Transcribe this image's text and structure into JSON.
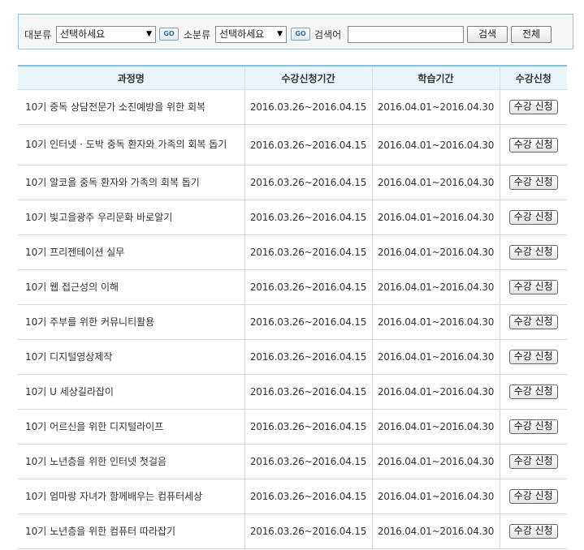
{
  "search": {
    "major_label": "대분류",
    "major_value": "선택하세요",
    "go_label": "GO",
    "minor_label": "소분류",
    "minor_value": "선택하세요",
    "keyword_label": "검색어",
    "keyword_value": "",
    "search_button": "검색",
    "all_button": "전체"
  },
  "table": {
    "headers": [
      "과정명",
      "수강신청기간",
      "학습기간",
      "수강신청"
    ],
    "apply_label": "수강 신청",
    "rows": [
      {
        "name": "10기 중독 상담전문가 소진예방을 위한 회복",
        "apply_period": "2016.03.26~2016.04.15",
        "study_period": "2016.04.01~2016.04.30"
      },
      {
        "name": "10기 인터넷 · 도박 중독 환자와 가족의 회복 돕기",
        "apply_period": "2016.03.26~2016.04.15",
        "study_period": "2016.04.01~2016.04.30"
      },
      {
        "name": "10기 알코올 중독 환자와 가족의 회복 돕기",
        "apply_period": "2016.03.26~2016.04.15",
        "study_period": "2016.04.01~2016.04.30"
      },
      {
        "name": "10기 빛고을광주 우리문화 바로알기",
        "apply_period": "2016.03.26~2016.04.15",
        "study_period": "2016.04.01~2016.04.30"
      },
      {
        "name": "10기 프리젠테이션 실무",
        "apply_period": "2016.03.26~2016.04.15",
        "study_period": "2016.04.01~2016.04.30"
      },
      {
        "name": "10기 웹 접근성의 이해",
        "apply_period": "2016.03.26~2016.04.15",
        "study_period": "2016.04.01~2016.04.30"
      },
      {
        "name": "10기 주부를 위한 커뮤니티활용",
        "apply_period": "2016.03.26~2016.04.15",
        "study_period": "2016.04.01~2016.04.30"
      },
      {
        "name": "10기 디지털영상제작",
        "apply_period": "2016.03.26~2016.04.15",
        "study_period": "2016.04.01~2016.04.30"
      },
      {
        "name": "10기 U 세상길라잡이",
        "apply_period": "2016.03.26~2016.04.15",
        "study_period": "2016.04.01~2016.04.30"
      },
      {
        "name": "10기 어르신을 위한 디지털라이프",
        "apply_period": "2016.03.26~2016.04.15",
        "study_period": "2016.04.01~2016.04.30"
      },
      {
        "name": "10기 노년층을 위한 인터넷 첫걸음",
        "apply_period": "2016.03.26~2016.04.15",
        "study_period": "2016.04.01~2016.04.30"
      },
      {
        "name": "10기 엄마랑 자녀가 함께배우는 컴퓨터세상",
        "apply_period": "2016.03.26~2016.04.15",
        "study_period": "2016.04.01~2016.04.30"
      },
      {
        "name": "10기 노년층을 위한 컴퓨터 따라잡기",
        "apply_period": "2016.03.26~2016.04.15",
        "study_period": "2016.04.01~2016.04.30"
      }
    ]
  }
}
